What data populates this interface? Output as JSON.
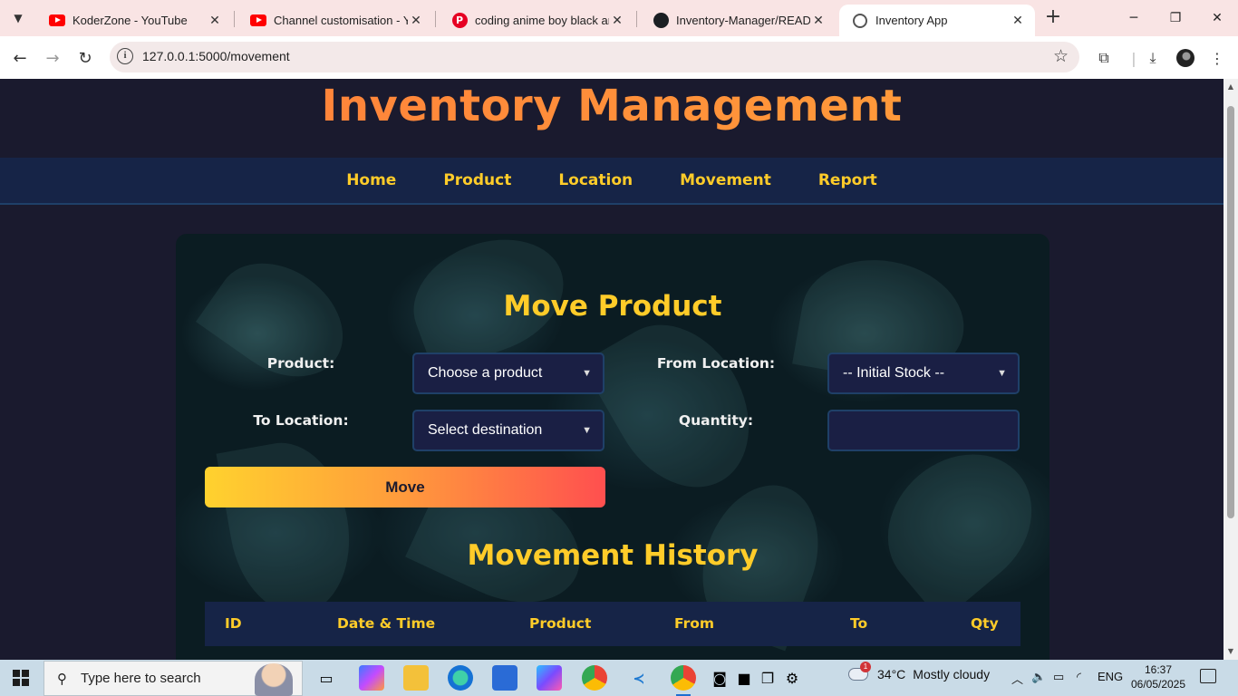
{
  "browser": {
    "tabs": [
      {
        "title": "KoderZone - YouTube",
        "icon": "youtube-icon"
      },
      {
        "title": "Channel customisation - You",
        "icon": "youtube-icon"
      },
      {
        "title": "coding anime boy black and",
        "icon": "pinterest-icon"
      },
      {
        "title": "Inventory-Manager/READM",
        "icon": "github-icon"
      },
      {
        "title": "Inventory App",
        "icon": "globe-icon"
      }
    ],
    "url": "127.0.0.1:5000/movement"
  },
  "app": {
    "title": "Inventory Management",
    "nav": [
      "Home",
      "Product",
      "Location",
      "Movement",
      "Report"
    ]
  },
  "form": {
    "heading": "Move Product",
    "product_label": "Product:",
    "product_value": "Choose a product",
    "from_label": "From Location:",
    "from_value": "-- Initial Stock --",
    "to_label": "To Location:",
    "to_value": "Select destination",
    "qty_label": "Quantity:",
    "qty_value": "",
    "submit_label": "Move"
  },
  "history": {
    "heading": "Movement History",
    "columns": [
      "ID",
      "Date & Time",
      "Product",
      "From",
      "To",
      "Qty"
    ]
  },
  "taskbar": {
    "search_placeholder": "Type here to search",
    "weather_temp": "34°C",
    "weather_desc": "Mostly cloudy",
    "weather_badge": "1",
    "language": "ENG",
    "time": "16:37",
    "date": "06/05/2025"
  },
  "colors": {
    "accent_yellow": "#ffcc29",
    "title_orange": "#ff8a3a",
    "nav_bg": "#162447",
    "page_bg": "#1a1a2e"
  }
}
